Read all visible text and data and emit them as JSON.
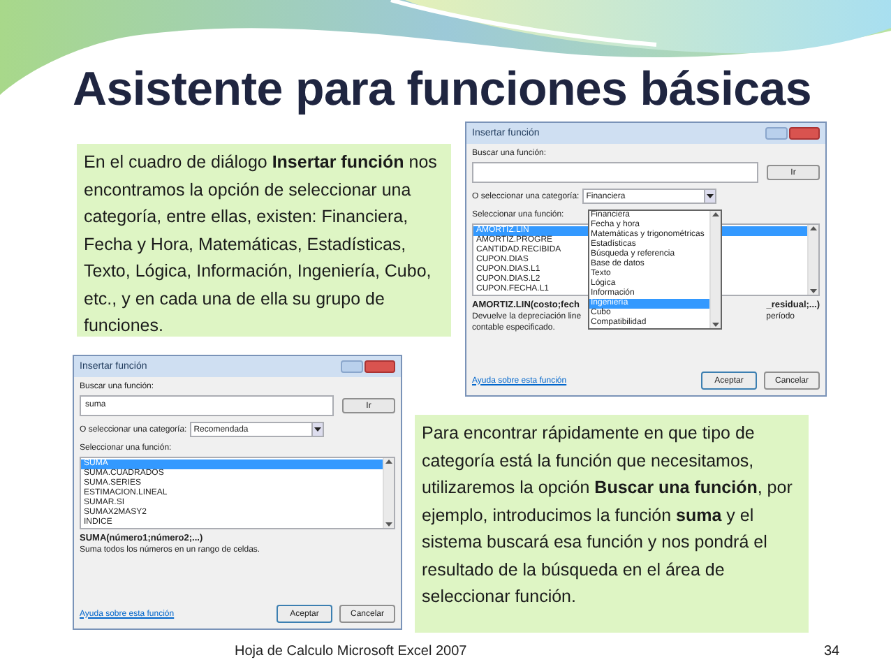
{
  "title": "Asistente para funciones básicas",
  "callouts": [
    {
      "text": "En el cuadro de diálogo **Insertar función** nos encontramos la opción de seleccionar una categoría, entre ellas, existen: Financiera, Fecha y Hora, Matemáticas, Estadísticas, Texto, Lógica, Información, Ingeniería, Cubo, etc., y en cada una de ella su grupo de funciones."
    },
    {
      "text": "Para encontrar rápidamente en que tipo de categoría está la función que necesitamos, utilizaremos la opción **Buscar una función**, por ejemplo, introducimos la función **suma** y el sistema buscará esa función y nos pondrá el resultado de la búsqueda en el área de seleccionar función."
    }
  ],
  "dialogs": [
    {
      "title": "Insertar función",
      "search_label": "Buscar una función:",
      "go_button": "Ir",
      "category_label": "O seleccionar una categoría:",
      "category_value": "Financiera",
      "list_label": "Seleccionar una función:",
      "functions": [
        {
          "name": "AMORTIZ.LIN",
          "selected": true
        },
        {
          "name": "AMORTIZ.PROGRE",
          "selected": false
        },
        {
          "name": "CANTIDAD.RECIBIDA",
          "selected": false
        },
        {
          "name": "CUPON.DIAS",
          "selected": false
        },
        {
          "name": "CUPON.DIAS.L1",
          "selected": false
        },
        {
          "name": "CUPON.DIAS.L2",
          "selected": false
        },
        {
          "name": "CUPON.FECHA.L1",
          "selected": false
        }
      ],
      "signature": [
        "AMORTIZ.LIN(costo;fech",
        "_residual;...)"
      ],
      "description": [
        [
          "Devuelve la depreciación line",
          "período"
        ],
        [
          "contable especificado."
        ]
      ],
      "help_link": "Ayuda sobre esta función",
      "buttons": [
        "Aceptar",
        "Cancelar"
      ],
      "dropdown": {
        "expanded": true,
        "items": [
          {
            "label": "Financiera",
            "selected": false
          },
          {
            "label": "Fecha y hora",
            "selected": false
          },
          {
            "label": "Matemáticas y trigonométricas",
            "selected": false
          },
          {
            "label": "Estadísticas",
            "selected": false
          },
          {
            "label": "Búsqueda y referencia",
            "selected": false
          },
          {
            "label": "Base de datos",
            "selected": false
          },
          {
            "label": "Texto",
            "selected": false
          },
          {
            "label": "Lógica",
            "selected": false
          },
          {
            "label": "Información",
            "selected": false
          },
          {
            "label": "Ingeniería",
            "selected": true
          },
          {
            "label": "Cubo",
            "selected": false
          },
          {
            "label": "Compatibilidad",
            "selected": false
          }
        ]
      }
    },
    {
      "title": "Insertar función",
      "search_label": "Buscar una función:",
      "search_value": "suma",
      "go_button": "Ir",
      "category_label": "O seleccionar una categoría:",
      "category_value": "Recomendada",
      "list_label": "Seleccionar una función:",
      "functions": [
        {
          "name": "SUMA",
          "selected": true
        },
        {
          "name": "SUMA.CUADRADOS",
          "selected": false
        },
        {
          "name": "SUMA.SERIES",
          "selected": false
        },
        {
          "name": "ESTIMACION.LINEAL",
          "selected": false
        },
        {
          "name": "SUMAR.SI",
          "selected": false
        },
        {
          "name": "SUMAX2MASY2",
          "selected": false
        },
        {
          "name": "INDICE",
          "selected": false
        }
      ],
      "signature": [
        "SUMA(número1;número2;...)"
      ],
      "description": [
        [
          "Suma todos los números en un rango de celdas."
        ]
      ],
      "help_link": "Ayuda sobre esta función",
      "buttons": [
        "Aceptar",
        "Cancelar"
      ]
    }
  ],
  "footer": {
    "text": "Hoja de Calculo Microsoft Excel 2007",
    "page": "34"
  }
}
